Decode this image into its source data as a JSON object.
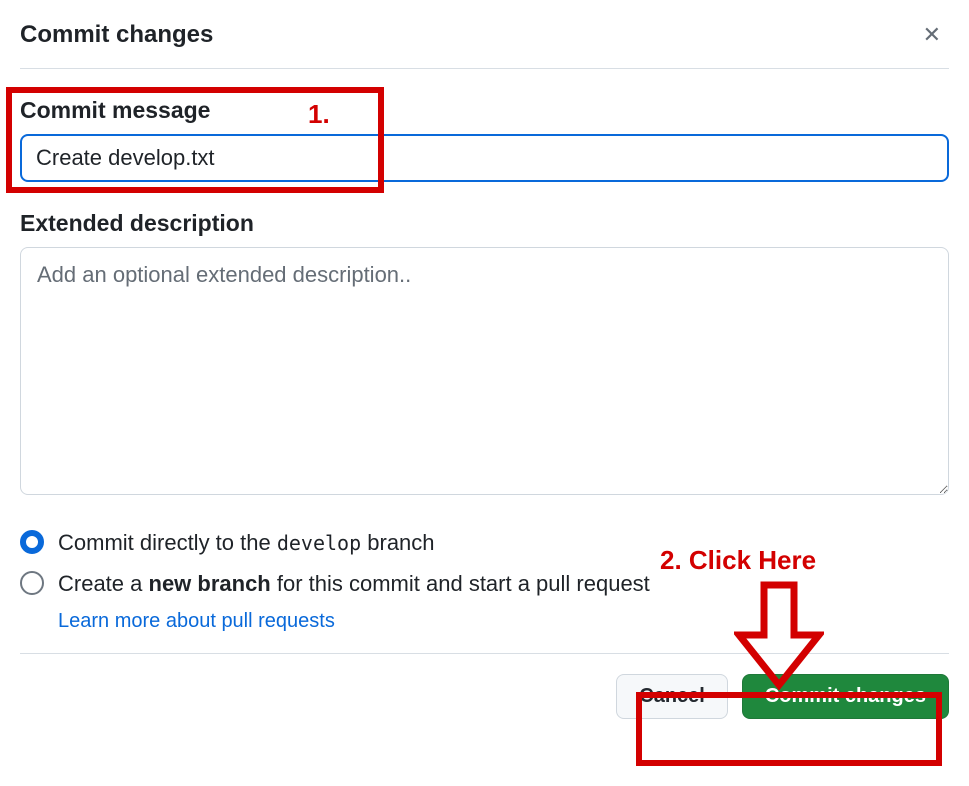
{
  "dialog": {
    "title": "Commit changes"
  },
  "commit_message": {
    "label": "Commit message",
    "value": "Create develop.txt"
  },
  "extended_description": {
    "label": "Extended description",
    "placeholder": "Add an optional extended description.."
  },
  "options": {
    "commit_direct": {
      "prefix": "Commit directly to the ",
      "branch": "develop",
      "suffix": " branch"
    },
    "new_branch": {
      "prefix": "Create a ",
      "bold": "new branch",
      "suffix": " for this commit and start a pull request"
    },
    "learn_link": "Learn more about pull requests"
  },
  "buttons": {
    "cancel": "Cancel",
    "commit": "Commit changes"
  },
  "annotations": {
    "step1": "1.",
    "step2": "2. Click Here"
  }
}
